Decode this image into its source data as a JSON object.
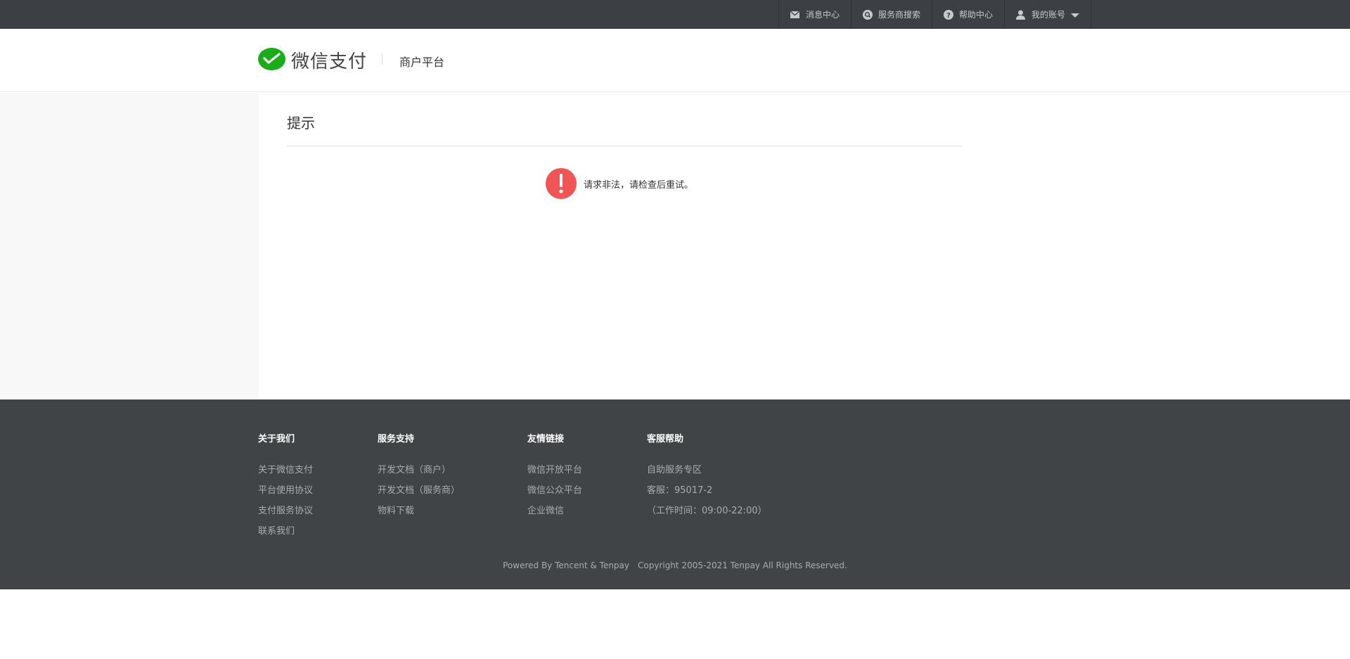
{
  "topnav": {
    "items": [
      {
        "label": "消息中心",
        "icon": "mail-icon"
      },
      {
        "label": "服务商搜索",
        "icon": "search-icon"
      },
      {
        "label": "帮助中心",
        "icon": "question-icon"
      },
      {
        "label": "我的账号",
        "icon": "user-icon"
      }
    ]
  },
  "header": {
    "logo_text": "微信支付",
    "subtitle": "商户平台"
  },
  "main": {
    "title": "提示",
    "message": "请求非法，请检查后重试。"
  },
  "footer": {
    "columns": [
      {
        "title": "关于我们",
        "links": [
          "关于微信支付",
          "平台使用协议",
          "支付服务协议",
          "联系我们"
        ]
      },
      {
        "title": "服务支持",
        "links": [
          "开发文档（商户）",
          "开发文档（服务商）",
          "物料下载"
        ]
      },
      {
        "title": "友情链接",
        "links": [
          "微信开放平台",
          "微信公众平台",
          "企业微信"
        ]
      },
      {
        "title": "客服帮助",
        "links": [
          "自助服务专区",
          "客服：95017-2",
          "（工作时间：09:00-22:00）"
        ]
      }
    ],
    "powered_by": "Powered By Tencent & Tenpay",
    "copyright": "Copyright 2005-2021 Tenpay All Rights Reserved."
  },
  "colors": {
    "topbar": "#3c3f43",
    "footer": "#414446",
    "brand_green": "#1aad19",
    "alert_red": "#f05555"
  }
}
